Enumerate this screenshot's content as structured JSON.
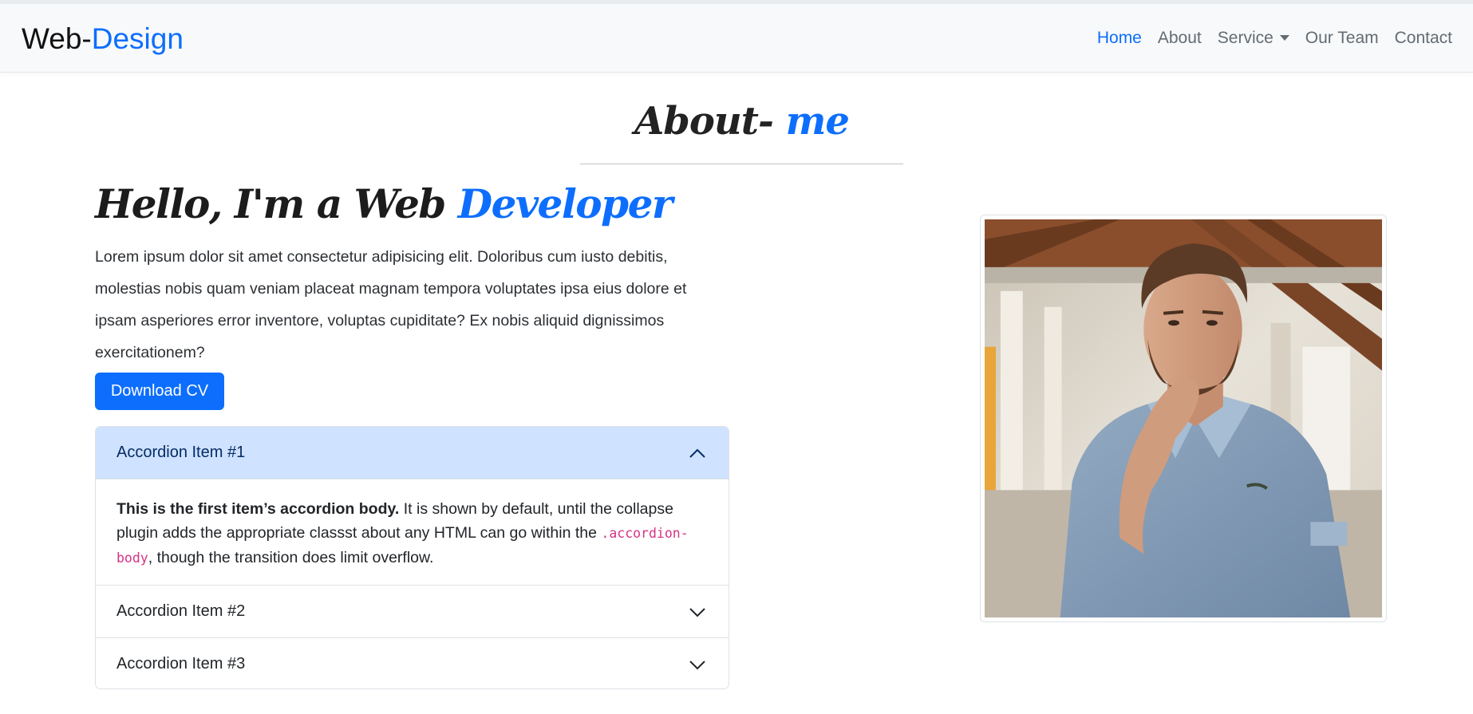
{
  "brand": {
    "prefix": "Web-",
    "accent": "Design"
  },
  "nav": {
    "items": [
      {
        "label": "Home"
      },
      {
        "label": "About"
      },
      {
        "label": "Service"
      },
      {
        "label": "Our Team"
      },
      {
        "label": "Contact"
      }
    ],
    "active": "Home"
  },
  "about": {
    "title_prefix": "About- ",
    "title_accent": "me",
    "heading_prefix": "Hello, I'm a Web ",
    "heading_accent": "Developer",
    "intro": "Lorem ipsum dolor sit amet consectetur adipisicing elit. Doloribus cum iusto debitis, molestias nobis quam veniam placeat magnam tempora voluptates ipsa eius dolore et ipsam asperiores error inventore, voluptas cupiditate? Ex nobis aliquid dignissimos exercitationem?",
    "download_label": "Download CV"
  },
  "accordion": {
    "items": [
      {
        "title": "Accordion Item #1",
        "expanded": true,
        "body_strong": "This is the first item’s accordion body.",
        "body_text": " It is shown by default, until the collapse plugin adds the appropriate classst about any HTML can go within the ",
        "body_code": ".accordion-body",
        "body_tail": ", though the transition does limit overflow."
      },
      {
        "title": "Accordion Item #2",
        "expanded": false
      },
      {
        "title": "Accordion Item #3",
        "expanded": false
      }
    ]
  },
  "colors": {
    "accent": "#0d6efd",
    "navbar_bg": "#f8f9fa",
    "accordion_open_bg": "#cfe2ff",
    "code": "#d63384"
  },
  "icons": {
    "expanded": "chevron-up-icon",
    "collapsed": "chevron-down-icon",
    "dropdown": "caret-down-icon"
  }
}
